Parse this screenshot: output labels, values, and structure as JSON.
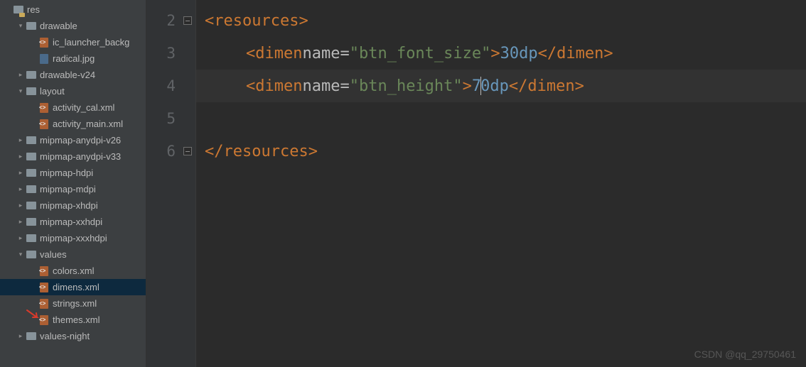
{
  "tree": {
    "root": "res",
    "items": [
      {
        "label": "res",
        "icon": "res-folder-icon",
        "indent": 0,
        "chev": "",
        "sel": false
      },
      {
        "label": "drawable",
        "icon": "folder-icon",
        "indent": 1,
        "chev": "v",
        "sel": false
      },
      {
        "label": "ic_launcher_backg",
        "icon": "xml-icon",
        "indent": 2,
        "chev": "",
        "sel": false
      },
      {
        "label": "radical.jpg",
        "icon": "img-icon",
        "indent": 2,
        "chev": "",
        "sel": false
      },
      {
        "label": "drawable-v24",
        "icon": "folder-icon",
        "indent": 1,
        "chev": ">",
        "sel": false
      },
      {
        "label": "layout",
        "icon": "folder-icon",
        "indent": 1,
        "chev": "v",
        "sel": false
      },
      {
        "label": "activity_cal.xml",
        "icon": "xml-icon",
        "indent": 2,
        "chev": "",
        "sel": false
      },
      {
        "label": "activity_main.xml",
        "icon": "xml-icon",
        "indent": 2,
        "chev": "",
        "sel": false
      },
      {
        "label": "mipmap-anydpi-v26",
        "icon": "folder-icon",
        "indent": 1,
        "chev": ">",
        "sel": false
      },
      {
        "label": "mipmap-anydpi-v33",
        "icon": "folder-icon",
        "indent": 1,
        "chev": ">",
        "sel": false
      },
      {
        "label": "mipmap-hdpi",
        "icon": "folder-icon",
        "indent": 1,
        "chev": ">",
        "sel": false
      },
      {
        "label": "mipmap-mdpi",
        "icon": "folder-icon",
        "indent": 1,
        "chev": ">",
        "sel": false
      },
      {
        "label": "mipmap-xhdpi",
        "icon": "folder-icon",
        "indent": 1,
        "chev": ">",
        "sel": false
      },
      {
        "label": "mipmap-xxhdpi",
        "icon": "folder-icon",
        "indent": 1,
        "chev": ">",
        "sel": false
      },
      {
        "label": "mipmap-xxxhdpi",
        "icon": "folder-icon",
        "indent": 1,
        "chev": ">",
        "sel": false
      },
      {
        "label": "values",
        "icon": "folder-icon",
        "indent": 1,
        "chev": "v",
        "sel": false
      },
      {
        "label": "colors.xml",
        "icon": "xml-icon",
        "indent": 2,
        "chev": "",
        "sel": false
      },
      {
        "label": "dimens.xml",
        "icon": "xml-icon",
        "indent": 2,
        "chev": "",
        "sel": true
      },
      {
        "label": "strings.xml",
        "icon": "xml-icon",
        "indent": 2,
        "chev": "",
        "sel": false
      },
      {
        "label": "themes.xml",
        "icon": "xml-icon",
        "indent": 2,
        "chev": "",
        "sel": false
      },
      {
        "label": "values-night",
        "icon": "folder-icon",
        "indent": 1,
        "chev": ">",
        "sel": false
      }
    ]
  },
  "editor": {
    "visible_line_numbers": [
      "2",
      "3",
      "4",
      "5",
      "6"
    ],
    "current_line_index": 2,
    "lines": [
      {
        "type": "open",
        "tag": "resources",
        "fold": true,
        "indent": 0
      },
      {
        "type": "elem",
        "tag": "dimen",
        "attr": "name",
        "val": "btn_font_size",
        "text": "30dp",
        "indent": 1
      },
      {
        "type": "elem",
        "tag": "dimen",
        "attr": "name",
        "val": "btn_height",
        "text": "70dp",
        "indent": 1,
        "caret_after": 1
      },
      {
        "type": "blank"
      },
      {
        "type": "close",
        "tag": "resources",
        "fold": true,
        "indent": 0
      }
    ]
  },
  "watermark": "CSDN @qq_29750461"
}
